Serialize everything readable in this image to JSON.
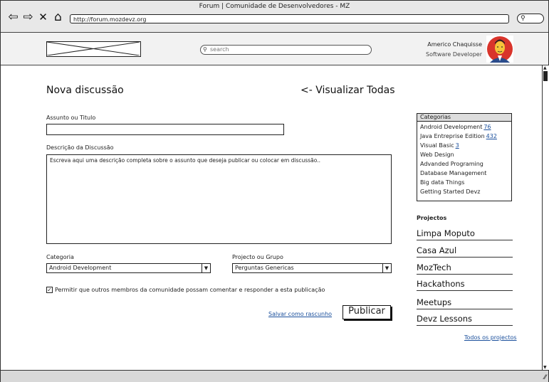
{
  "browser": {
    "title": "Forum | Comunidade de Desenvolvedores - MZ",
    "url": "http://forum.mozdevz.org"
  },
  "header": {
    "search_placeholder": "search",
    "user_name": "Americo Chaquisse",
    "user_role": "Software Developer"
  },
  "main": {
    "title": "Nova discussão",
    "view_all": "<- Visualizar Todas",
    "subject_label": "Assunto ou Titulo",
    "description_label": "Descrição da Discussão",
    "description_placeholder": "Escreva aqui uma descrição completa sobre o assunto que deseja publicar ou colocar em discussão..",
    "category_label": "Categoria",
    "category_value": "Android Development",
    "project_label": "Projecto ou Grupo",
    "project_value": "Perguntas Genericas",
    "allow_comments_label": "Permitir que outros membros da comunidade possam comentar e responder a esta publicação",
    "allow_comments_checked": true,
    "save_draft": "Salvar como rascunho",
    "publish": "Publicar"
  },
  "sidebar": {
    "categories_title": "Categorias",
    "categories": [
      {
        "name": "Android Development",
        "count": "76"
      },
      {
        "name": "Java Entreprise Edition",
        "count": "432"
      },
      {
        "name": "Visual Basic",
        "count": "3"
      },
      {
        "name": "Web Design",
        "count": ""
      },
      {
        "name": "Advanded Programing",
        "count": ""
      },
      {
        "name": "Database Management",
        "count": ""
      },
      {
        "name": "Big data Things",
        "count": ""
      },
      {
        "name": "Getting Started Devz",
        "count": ""
      }
    ],
    "projects_title": "Projectos",
    "projects": [
      "Limpa Moputo",
      "Casa Azul",
      "MozTech",
      "Hackathons",
      "Meetups",
      "Devz Lessons"
    ],
    "all_projects": "Todos os projectos"
  },
  "icons": [
    "back-icon",
    "forward-icon",
    "close-icon",
    "home-icon",
    "search-icon",
    "checkbox-checked-icon",
    "dropdown-arrow-icon",
    "resize-icon"
  ],
  "colors": {
    "link": "#1a4f9c",
    "avatar_bg": "#d9342b",
    "avatar_skin": "#f5c43a"
  }
}
